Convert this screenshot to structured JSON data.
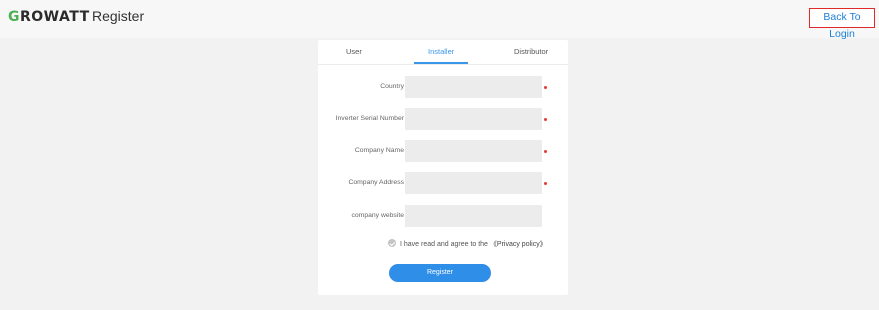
{
  "header": {
    "logo_first": "G",
    "logo_rest": "ROWATT",
    "title": "Register",
    "back_label": "Back To Login"
  },
  "tabs": [
    {
      "label": "User",
      "active": false
    },
    {
      "label": "Installer",
      "active": true
    },
    {
      "label": "Distributor",
      "active": false
    }
  ],
  "form": {
    "fields": [
      {
        "label": "Country",
        "value": "",
        "required": true
      },
      {
        "label": "Inverter Serial Number",
        "value": "",
        "required": true
      },
      {
        "label": "Company Name",
        "value": "",
        "required": true
      },
      {
        "label": "Company Address",
        "value": "",
        "required": true
      },
      {
        "label": "company website",
        "value": "",
        "required": false
      }
    ],
    "agree_text": "I have read and agree to the ",
    "privacy_link": "《Privacy policy》",
    "register_label": "Register"
  },
  "colors": {
    "accent": "#3a96e6",
    "required": "#e53935",
    "logo_green": "#4caf50",
    "highlight_border": "#e02a2a"
  }
}
